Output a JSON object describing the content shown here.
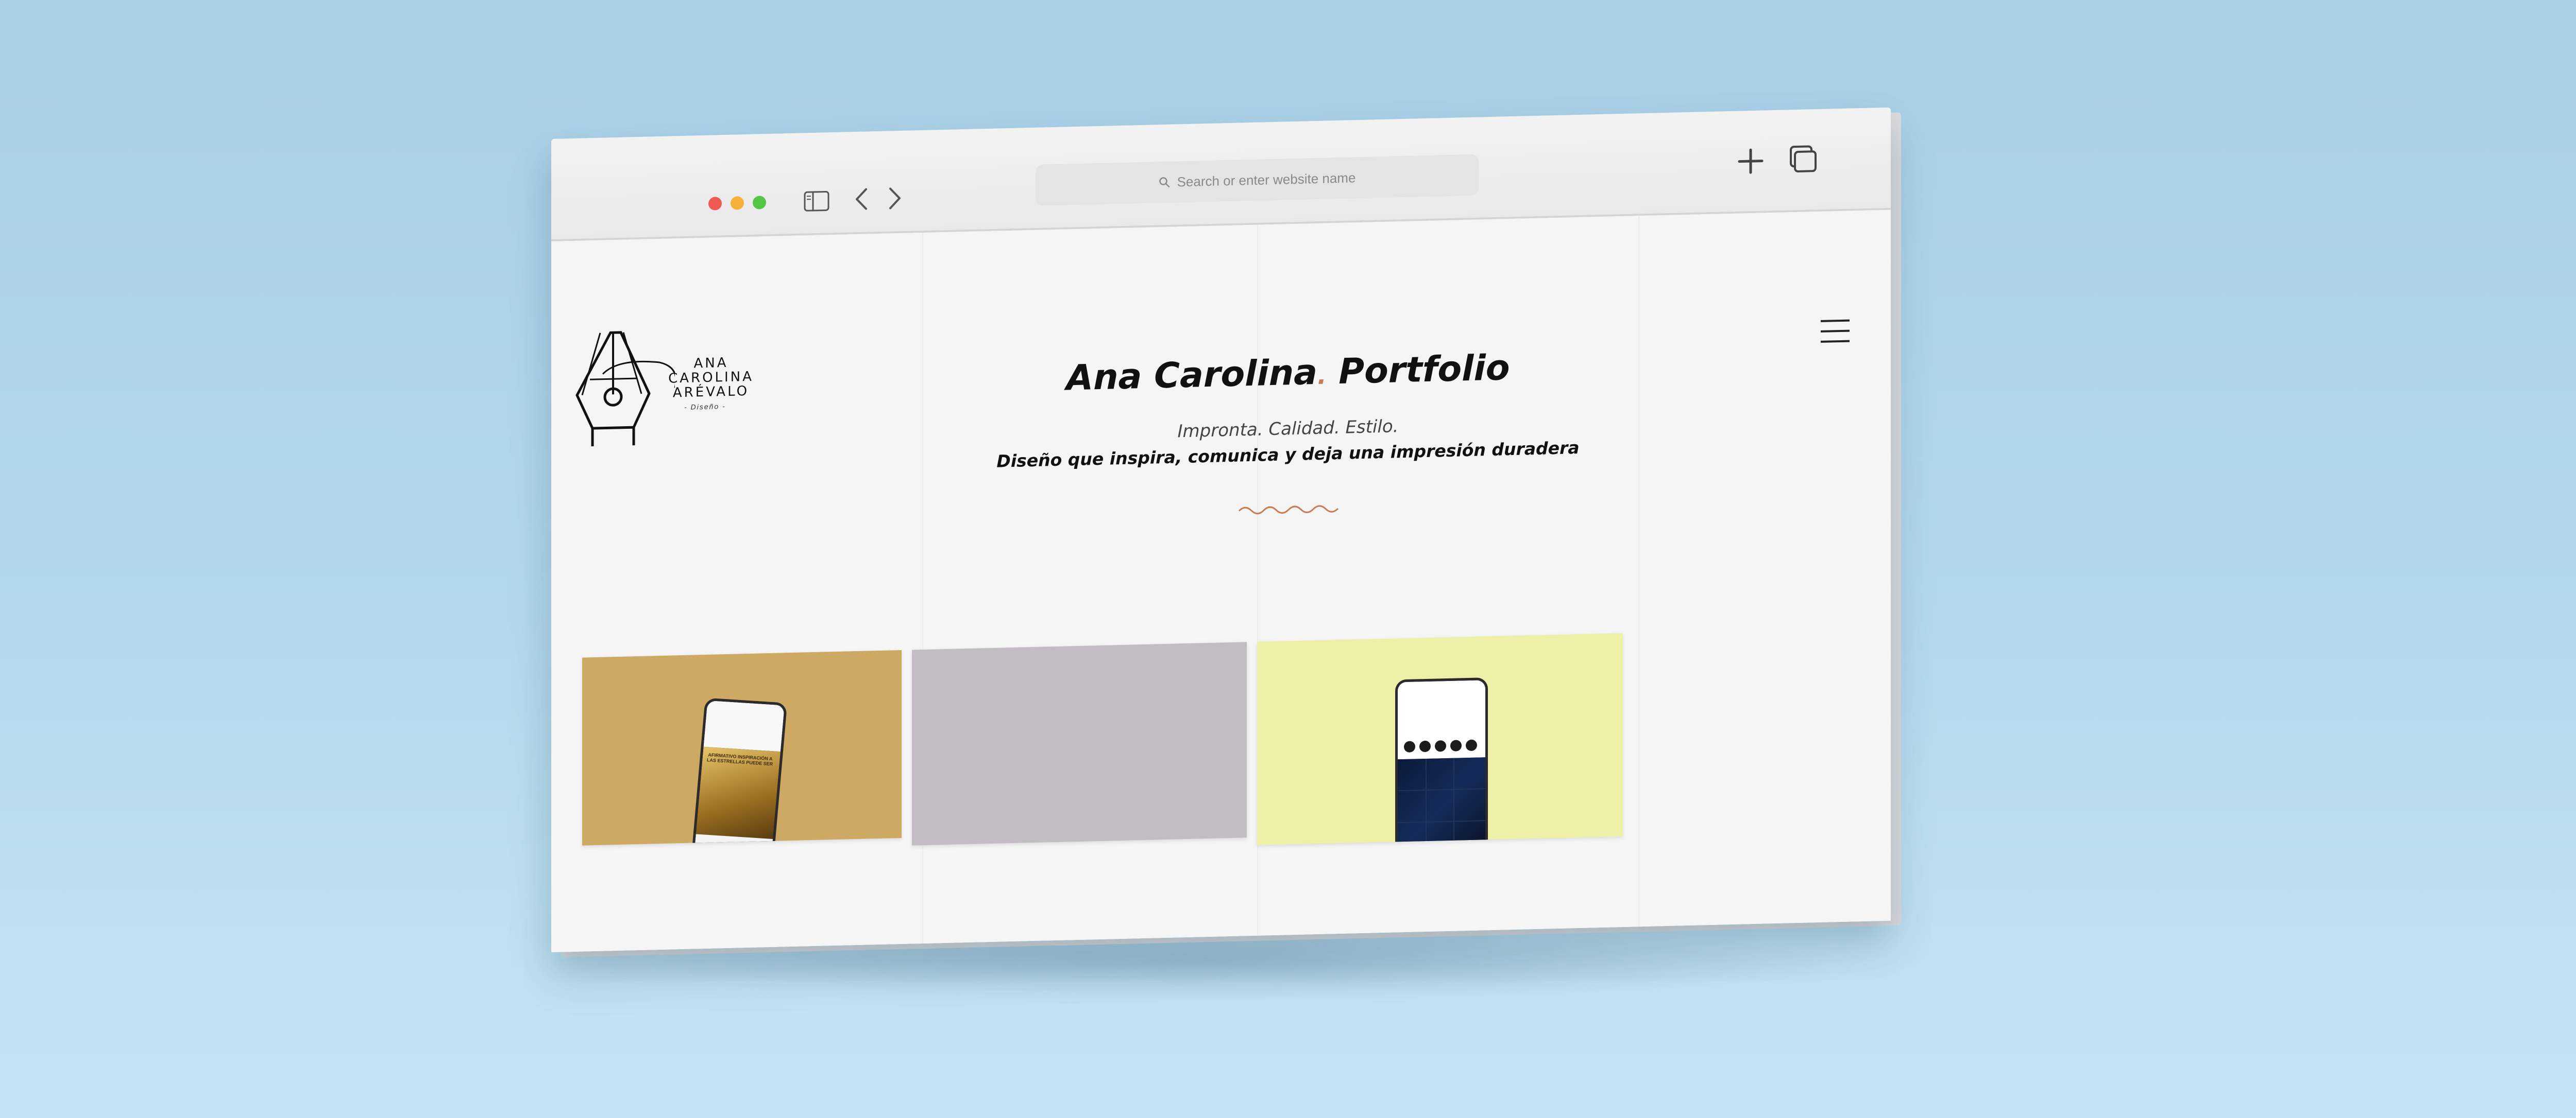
{
  "browser": {
    "address_placeholder": "Search or enter website name",
    "icons": [
      "sidebar-icon",
      "back-arrow-icon",
      "forward-arrow-icon",
      "search-icon",
      "new-tab-plus-icon",
      "tabs-overview-icon"
    ],
    "traffic_lights": [
      "#ee5a52",
      "#f4b13c",
      "#55c546"
    ]
  },
  "site": {
    "logo": {
      "line1": "ANA",
      "line2": "CAROLINA",
      "line3": "ARÉVALO",
      "sub": "- Diseño -"
    },
    "title_name": "Ana Carolina",
    "title_dot": ".",
    "title_rest": " Portfolio",
    "tagline": "Impronta. Calidad. Estilo.",
    "subline": "Diseño que inspira, comunica y deja una impresión duradera",
    "menu_icon": "hamburger-menu-icon",
    "accent_color": "#c97b55"
  },
  "portfolio": {
    "cards": [
      {
        "color": "#cda964",
        "mockup": "phone",
        "phone_caption": "AFIRMATIVO INSPIRACIÓN A LAS ESTRELLAS PUEDE SER"
      },
      {
        "color": "#c2bcc3",
        "mockup": "none"
      },
      {
        "color": "#eff0a8",
        "mockup": "phone"
      }
    ]
  }
}
